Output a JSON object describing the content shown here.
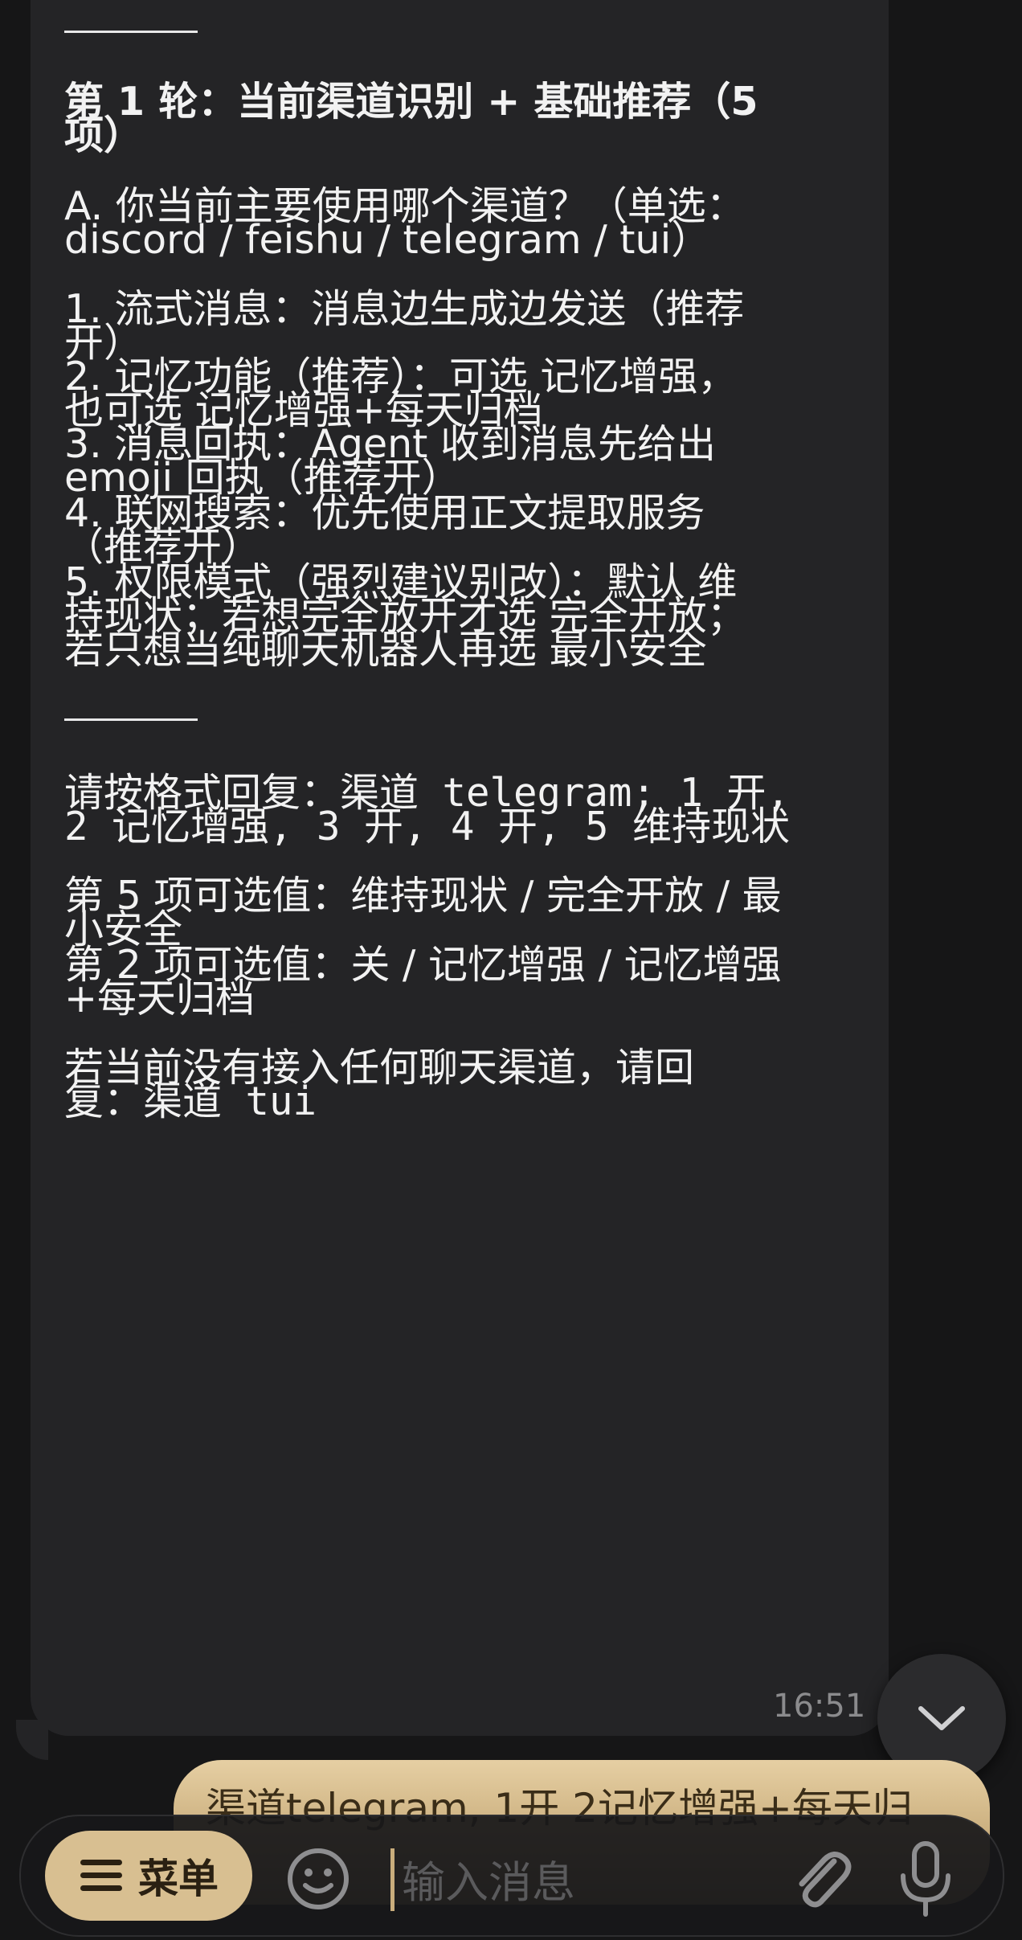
{
  "message": {
    "heading_line1": "第 1 轮：当前渠道识别 + 基础推荐（5",
    "heading_line2": "项）",
    "question_a_line1": "A. 你当前主要使用哪个渠道？（单选：",
    "question_a_line2_options": "discord / feishu / telegram / tui）",
    "items": [
      "1. 流式消息：消息边生成边发送（推荐",
      "开）",
      "2. 记忆功能（推荐）：可选 记忆增强，",
      "也可选 记忆增强+每天归档",
      "3. 消息回执：Agent 收到消息先给出",
      "emoji 回执（推荐开）",
      "4. 联网搜索：优先使用正文提取服务",
      "（推荐开）",
      "5. 权限模式（强烈建议别改）：默认 维",
      "持现状；若想完全放开才选 完全开放；",
      "若只想当纯聊天机器人再选 最小安全"
    ],
    "reply_format_line1": "请按格式回复：渠道 telegram; 1 开,",
    "reply_format_line2": "2 记忆增强, 3 开, 4 开, 5 维持现状",
    "opt5_line1": "第 5 项可选值：维持现状 / 完全开放 / 最",
    "opt5_line2": "小安全",
    "opt2_line1": "第 2 项可选值：关 / 记忆增强 / 记忆增强",
    "opt2_line2": "+每天归档",
    "noconn_line1": "若当前没有接入任何聊天渠道，请回",
    "noconn_line2": "复：渠道 tui",
    "time": "16:51"
  },
  "outgoing": {
    "text": "渠道telegram, 1开 2记忆增强+每天归"
  },
  "input_bar": {
    "menu_label": "菜单",
    "placeholder": "输入消息"
  },
  "icons": {
    "menu": "hamburger-icon",
    "emoji": "smiley-icon",
    "attach": "paperclip-icon",
    "mic": "microphone-icon",
    "scroll": "chevron-down-icon"
  },
  "colors": {
    "accent": "#d8bf91",
    "bubble_in": "#242426",
    "background": "#161617"
  }
}
